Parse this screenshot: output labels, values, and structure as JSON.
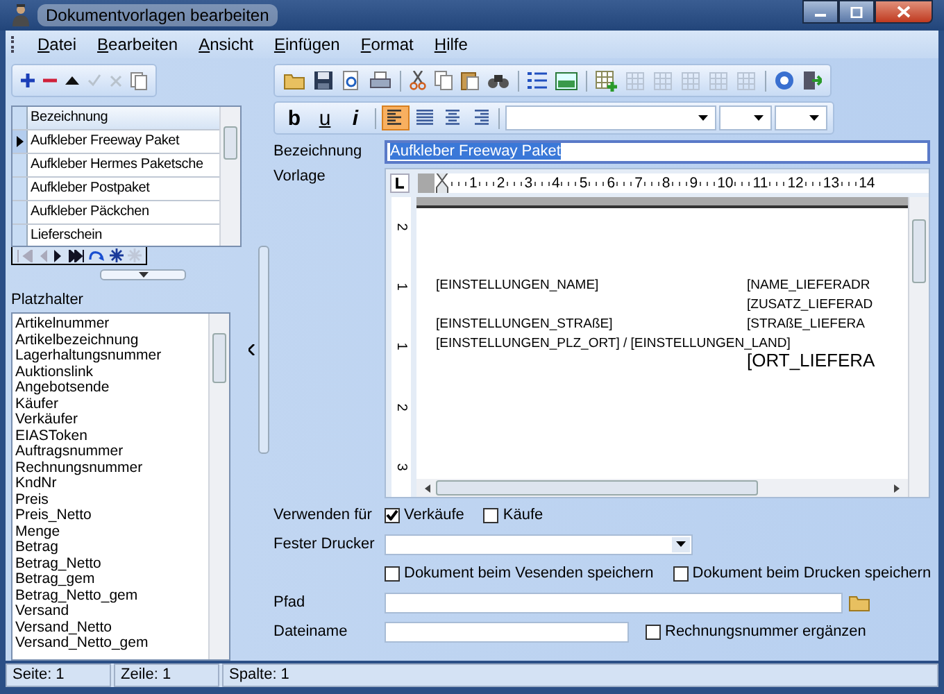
{
  "window": {
    "title": "Dokumentvorlagen bearbeiten"
  },
  "menu": [
    {
      "label": "Datei"
    },
    {
      "label": "Bearbeiten"
    },
    {
      "label": "Ansicht"
    },
    {
      "label": "Einfügen"
    },
    {
      "label": "Format"
    },
    {
      "label": "Hilfe"
    }
  ],
  "templates": {
    "column": "Bezeichnung",
    "rows": [
      {
        "name": "Aufkleber Freeway Paket",
        "selected": true
      },
      {
        "name": "Aufkleber Hermes Paketsche",
        "selected": false
      },
      {
        "name": "Aufkleber Postpaket",
        "selected": false
      },
      {
        "name": "Aufkleber Päckchen",
        "selected": false
      },
      {
        "name": "Lieferschein",
        "selected": false
      }
    ]
  },
  "placeholders": {
    "label": "Platzhalter",
    "items": [
      "Artikelnummer",
      "Artikelbezeichnung",
      "Lagerhaltungsnummer",
      "Auktionslink",
      "Angebotsende",
      "Käufer",
      "Verkäufer",
      "EIASToken",
      "Auftragsnummer",
      "Rechnungsnummer",
      "KndNr",
      "Preis",
      "Preis_Netto",
      "Menge",
      "Betrag",
      "Betrag_Netto",
      "Betrag_gem",
      "Betrag_Netto_gem",
      "Versand",
      "Versand_Netto",
      "Versand_Netto_gem"
    ]
  },
  "format_toolbar": {
    "styles": [
      {
        "label": "b",
        "kind": "bold"
      },
      {
        "label": "u",
        "kind": "underline"
      },
      {
        "label": "i",
        "kind": "italic"
      }
    ],
    "alignments": [
      {
        "kind": "left",
        "selected": true
      },
      {
        "kind": "justify",
        "selected": false
      },
      {
        "kind": "center",
        "selected": false
      },
      {
        "kind": "right",
        "selected": false
      }
    ]
  },
  "name_row": {
    "label": "Bezeichnung",
    "value": "Aufkleber Freeway Paket",
    "text_selected": true
  },
  "template_row": {
    "label": "Vorlage",
    "ruler": [
      "1",
      "2",
      "3",
      "4",
      "5",
      "6",
      "7",
      "8",
      "9",
      "10",
      "11",
      "12",
      "13",
      "14"
    ],
    "vertical_ruler": [
      "2",
      "1",
      "1",
      "2",
      "3"
    ],
    "document": [
      {
        "left": "[EINSTELLUNGEN_NAME]",
        "right": "[NAME_LIEFERADR"
      },
      {
        "right": "[ZUSATZ_LIEFERAD"
      },
      {
        "left": "[EINSTELLUNGEN_STRAßE]",
        "right": "[STRAßE_LIEFERA"
      },
      {
        "left": "[EINSTELLUNGEN_PLZ_ORT] / [EINSTELLUNGEN_LAND]"
      },
      {
        "right": "[ORT_LIEFERA",
        "large": true
      }
    ]
  },
  "usage": {
    "label": "Verwenden für",
    "options": [
      {
        "label": "Verkäufe",
        "checked": true
      },
      {
        "label": "Käufe",
        "checked": false
      }
    ]
  },
  "printer": {
    "label": "Fester Drucker"
  },
  "save_options": [
    {
      "label": "Dokument beim Vesenden speichern",
      "checked": false
    },
    {
      "label": "Dokument beim Drucken speichern",
      "checked": false
    }
  ],
  "path": {
    "label": "Pfad"
  },
  "filename": {
    "label": "Dateiname",
    "option": {
      "label": "Rechnungsnummer ergänzen",
      "checked": false
    }
  },
  "status_bar": [
    "Seite: 1",
    "Zeile: 1",
    "Spalte: 1"
  ]
}
